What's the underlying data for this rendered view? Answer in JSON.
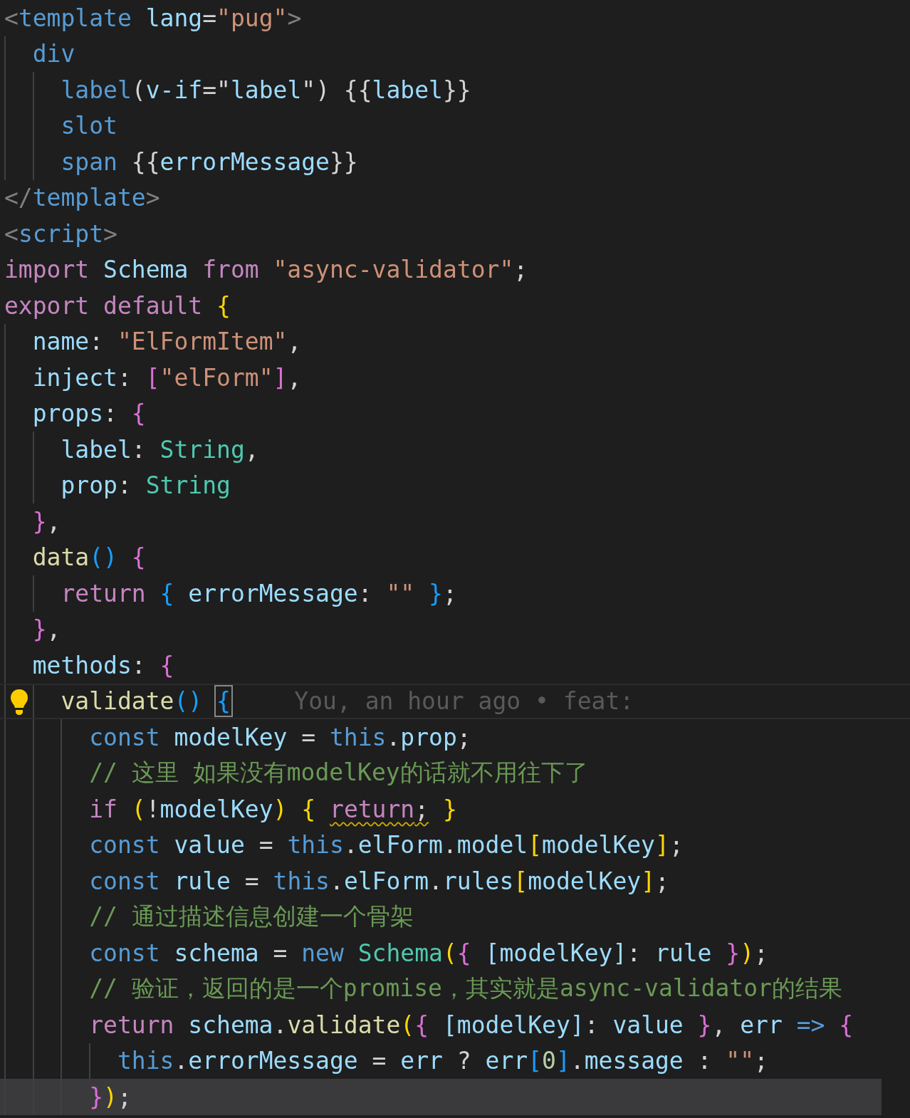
{
  "lines": [
    {
      "tokens": [
        {
          "text": "<",
          "kind": "p"
        },
        {
          "text": "template ",
          "kind": "tag"
        },
        {
          "text": "lang",
          "kind": "attr"
        },
        {
          "text": "=",
          "kind": "plain"
        },
        {
          "text": "\"pug\"",
          "kind": "str"
        },
        {
          "text": ">",
          "kind": "p"
        }
      ],
      "children": [
        {
          "tokens": [
            {
              "text": "div",
              "kind": "tag"
            }
          ],
          "children": [
            {
              "tokens": [
                {
                  "text": "label",
                  "kind": "tag"
                },
                {
                  "text": "(",
                  "kind": "plain"
                },
                {
                  "text": "v-if",
                  "kind": "attr"
                },
                {
                  "text": "=\"",
                  "kind": "plain"
                },
                {
                  "text": "label",
                  "kind": "var"
                },
                {
                  "text": "\") {{",
                  "kind": "plain"
                },
                {
                  "text": "label",
                  "kind": "var"
                },
                {
                  "text": "}}",
                  "kind": "plain"
                }
              ]
            },
            {
              "tokens": [
                {
                  "text": "slot",
                  "kind": "tag"
                }
              ]
            },
            {
              "tokens": [
                {
                  "text": "span",
                  "kind": "tag"
                },
                {
                  "text": " {{",
                  "kind": "plain"
                },
                {
                  "text": "errorMessage",
                  "kind": "var"
                },
                {
                  "text": "}}",
                  "kind": "plain"
                }
              ]
            }
          ]
        }
      ]
    },
    {
      "tokens": [
        {
          "text": "</",
          "kind": "p"
        },
        {
          "text": "template",
          "kind": "tag"
        },
        {
          "text": ">",
          "kind": "p"
        }
      ]
    },
    {
      "tokens": [
        {
          "text": "<",
          "kind": "p"
        },
        {
          "text": "script",
          "kind": "tag"
        },
        {
          "text": ">",
          "kind": "p"
        }
      ]
    },
    {
      "tokens": [
        {
          "text": "import ",
          "kind": "ctl"
        },
        {
          "text": "Schema ",
          "kind": "var"
        },
        {
          "text": "from ",
          "kind": "ctl"
        },
        {
          "text": "\"async-validator\"",
          "kind": "str"
        },
        {
          "text": ";",
          "kind": "plain"
        }
      ]
    },
    {
      "tokens": [
        {
          "text": "export default ",
          "kind": "ctl"
        },
        {
          "text": "{",
          "kind": "b1"
        }
      ],
      "children": [
        {
          "tokens": [
            {
              "text": "name",
              "kind": "var"
            },
            {
              "text": ": ",
              "kind": "plain"
            },
            {
              "text": "\"ElFormItem\"",
              "kind": "str"
            },
            {
              "text": ",",
              "kind": "plain"
            }
          ]
        },
        {
          "tokens": [
            {
              "text": "inject",
              "kind": "var"
            },
            {
              "text": ": ",
              "kind": "plain"
            },
            {
              "text": "[",
              "kind": "b2"
            },
            {
              "text": "\"elForm\"",
              "kind": "str"
            },
            {
              "text": "]",
              "kind": "b2"
            },
            {
              "text": ",",
              "kind": "plain"
            }
          ]
        },
        {
          "tokens": [
            {
              "text": "props",
              "kind": "var"
            },
            {
              "text": ": ",
              "kind": "plain"
            },
            {
              "text": "{",
              "kind": "b2"
            }
          ],
          "children": [
            {
              "tokens": [
                {
                  "text": "label",
                  "kind": "var"
                },
                {
                  "text": ": ",
                  "kind": "plain"
                },
                {
                  "text": "String",
                  "kind": "type"
                },
                {
                  "text": ",",
                  "kind": "plain"
                }
              ]
            },
            {
              "tokens": [
                {
                  "text": "prop",
                  "kind": "var"
                },
                {
                  "text": ": ",
                  "kind": "plain"
                },
                {
                  "text": "String",
                  "kind": "type"
                }
              ]
            }
          ]
        },
        {
          "tokens": [
            {
              "text": "}",
              "kind": "b2"
            },
            {
              "text": ",",
              "kind": "plain"
            }
          ]
        },
        {
          "tokens": [
            {
              "text": "data",
              "kind": "fn"
            },
            {
              "text": "() ",
              "kind": "b3"
            },
            {
              "text": "{",
              "kind": "b2"
            }
          ],
          "children": [
            {
              "tokens": [
                {
                  "text": "return ",
                  "kind": "ctl"
                },
                {
                  "text": "{ ",
                  "kind": "b3"
                },
                {
                  "text": "errorMessage",
                  "kind": "var"
                },
                {
                  "text": ": ",
                  "kind": "plain"
                },
                {
                  "text": "\"\" ",
                  "kind": "str"
                },
                {
                  "text": "}",
                  "kind": "b3"
                },
                {
                  "text": ";",
                  "kind": "plain"
                }
              ]
            }
          ]
        },
        {
          "tokens": [
            {
              "text": "}",
              "kind": "b2"
            },
            {
              "text": ",",
              "kind": "plain"
            }
          ]
        },
        {
          "tokens": [
            {
              "text": "methods",
              "kind": "var"
            },
            {
              "text": ": ",
              "kind": "plain"
            },
            {
              "text": "{",
              "kind": "b2"
            }
          ],
          "children": [
            {
              "current": true,
              "blame": "You, an hour ago • feat:",
              "tokens": [
                {
                  "text": "validate",
                  "kind": "fn"
                },
                {
                  "text": "() ",
                  "kind": "b3"
                },
                {
                  "text": "{",
                  "kind": "b3",
                  "matched": true
                }
              ],
              "children": [
                {
                  "tokens": [
                    {
                      "text": "const ",
                      "kind": "kw"
                    },
                    {
                      "text": "modelKey",
                      "kind": "var"
                    },
                    {
                      "text": " = ",
                      "kind": "plain"
                    },
                    {
                      "text": "this",
                      "kind": "kw"
                    },
                    {
                      "text": ".",
                      "kind": "plain"
                    },
                    {
                      "text": "prop",
                      "kind": "var"
                    },
                    {
                      "text": ";",
                      "kind": "plain"
                    }
                  ]
                },
                {
                  "tokens": [
                    {
                      "text": "// 这里 如果没有modelKey的话就不用往下了",
                      "kind": "cmt"
                    }
                  ]
                },
                {
                  "tokens": [
                    {
                      "text": "if ",
                      "kind": "ctl"
                    },
                    {
                      "text": "(",
                      "kind": "b1"
                    },
                    {
                      "text": "!",
                      "kind": "plain"
                    },
                    {
                      "text": "modelKey",
                      "kind": "var"
                    },
                    {
                      "text": ") ",
                      "kind": "b1"
                    },
                    {
                      "text": "{ ",
                      "kind": "b1"
                    },
                    {
                      "text": "return",
                      "kind": "ctl",
                      "warning": true
                    },
                    {
                      "text": ";",
                      "kind": "plain",
                      "warning": true
                    },
                    {
                      "text": " }",
                      "kind": "b1"
                    }
                  ]
                },
                {
                  "tokens": [
                    {
                      "text": "const ",
                      "kind": "kw"
                    },
                    {
                      "text": "value",
                      "kind": "var"
                    },
                    {
                      "text": " = ",
                      "kind": "plain"
                    },
                    {
                      "text": "this",
                      "kind": "kw"
                    },
                    {
                      "text": ".",
                      "kind": "plain"
                    },
                    {
                      "text": "elForm",
                      "kind": "var"
                    },
                    {
                      "text": ".",
                      "kind": "plain"
                    },
                    {
                      "text": "model",
                      "kind": "var"
                    },
                    {
                      "text": "[",
                      "kind": "b1"
                    },
                    {
                      "text": "modelKey",
                      "kind": "var"
                    },
                    {
                      "text": "]",
                      "kind": "b1"
                    },
                    {
                      "text": ";",
                      "kind": "plain"
                    }
                  ]
                },
                {
                  "tokens": [
                    {
                      "text": "const ",
                      "kind": "kw"
                    },
                    {
                      "text": "rule",
                      "kind": "var"
                    },
                    {
                      "text": " = ",
                      "kind": "plain"
                    },
                    {
                      "text": "this",
                      "kind": "kw"
                    },
                    {
                      "text": ".",
                      "kind": "plain"
                    },
                    {
                      "text": "elForm",
                      "kind": "var"
                    },
                    {
                      "text": ".",
                      "kind": "plain"
                    },
                    {
                      "text": "rules",
                      "kind": "var"
                    },
                    {
                      "text": "[",
                      "kind": "b1"
                    },
                    {
                      "text": "modelKey",
                      "kind": "var"
                    },
                    {
                      "text": "]",
                      "kind": "b1"
                    },
                    {
                      "text": ";",
                      "kind": "plain"
                    }
                  ]
                },
                {
                  "tokens": [
                    {
                      "text": "// 通过描述信息创建一个骨架",
                      "kind": "cmt"
                    }
                  ]
                },
                {
                  "tokens": [
                    {
                      "text": "const ",
                      "kind": "kw"
                    },
                    {
                      "text": "schema",
                      "kind": "var"
                    },
                    {
                      "text": " = ",
                      "kind": "plain"
                    },
                    {
                      "text": "new ",
                      "kind": "kw"
                    },
                    {
                      "text": "Schema",
                      "kind": "type"
                    },
                    {
                      "text": "(",
                      "kind": "b1"
                    },
                    {
                      "text": "{ ",
                      "kind": "b2"
                    },
                    {
                      "text": "[modelKey]",
                      "kind": "var"
                    },
                    {
                      "text": ": ",
                      "kind": "plain"
                    },
                    {
                      "text": "rule ",
                      "kind": "var"
                    },
                    {
                      "text": "}",
                      "kind": "b2"
                    },
                    {
                      "text": ")",
                      "kind": "b1"
                    },
                    {
                      "text": ";",
                      "kind": "plain"
                    }
                  ]
                },
                {
                  "tokens": [
                    {
                      "text": "// 验证，返回的是一个promise，其实就是async-validator的结果",
                      "kind": "cmt"
                    }
                  ]
                },
                {
                  "tokens": [
                    {
                      "text": "return ",
                      "kind": "ctl"
                    },
                    {
                      "text": "schema",
                      "kind": "var"
                    },
                    {
                      "text": ".",
                      "kind": "plain"
                    },
                    {
                      "text": "validate",
                      "kind": "fn"
                    },
                    {
                      "text": "(",
                      "kind": "b1"
                    },
                    {
                      "text": "{ ",
                      "kind": "b2"
                    },
                    {
                      "text": "[modelKey]",
                      "kind": "var"
                    },
                    {
                      "text": ": ",
                      "kind": "plain"
                    },
                    {
                      "text": "value ",
                      "kind": "var"
                    },
                    {
                      "text": "}",
                      "kind": "b2"
                    },
                    {
                      "text": ", ",
                      "kind": "plain"
                    },
                    {
                      "text": "err ",
                      "kind": "var"
                    },
                    {
                      "text": "=> ",
                      "kind": "kw"
                    },
                    {
                      "text": "{",
                      "kind": "b2"
                    }
                  ],
                  "children": [
                    {
                      "tokens": [
                        {
                          "text": "this",
                          "kind": "kw"
                        },
                        {
                          "text": ".",
                          "kind": "plain"
                        },
                        {
                          "text": "errorMessage",
                          "kind": "var"
                        },
                        {
                          "text": " = ",
                          "kind": "plain"
                        },
                        {
                          "text": "err",
                          "kind": "var"
                        },
                        {
                          "text": " ? ",
                          "kind": "plain"
                        },
                        {
                          "text": "err",
                          "kind": "var"
                        },
                        {
                          "text": "[",
                          "kind": "b3"
                        },
                        {
                          "text": "0",
                          "kind": "num"
                        },
                        {
                          "text": "]",
                          "kind": "b3"
                        },
                        {
                          "text": ".",
                          "kind": "plain"
                        },
                        {
                          "text": "message",
                          "kind": "var"
                        },
                        {
                          "text": " : ",
                          "kind": "plain"
                        },
                        {
                          "text": "\"\"",
                          "kind": "str"
                        },
                        {
                          "text": ";",
                          "kind": "plain"
                        }
                      ]
                    }
                  ]
                },
                {
                  "highlighted": true,
                  "tokens": [
                    {
                      "text": "}",
                      "kind": "b2"
                    },
                    {
                      "text": ")",
                      "kind": "b1"
                    },
                    {
                      "text": ";",
                      "kind": "plain"
                    }
                  ]
                }
              ]
            }
          ]
        }
      ]
    }
  ]
}
